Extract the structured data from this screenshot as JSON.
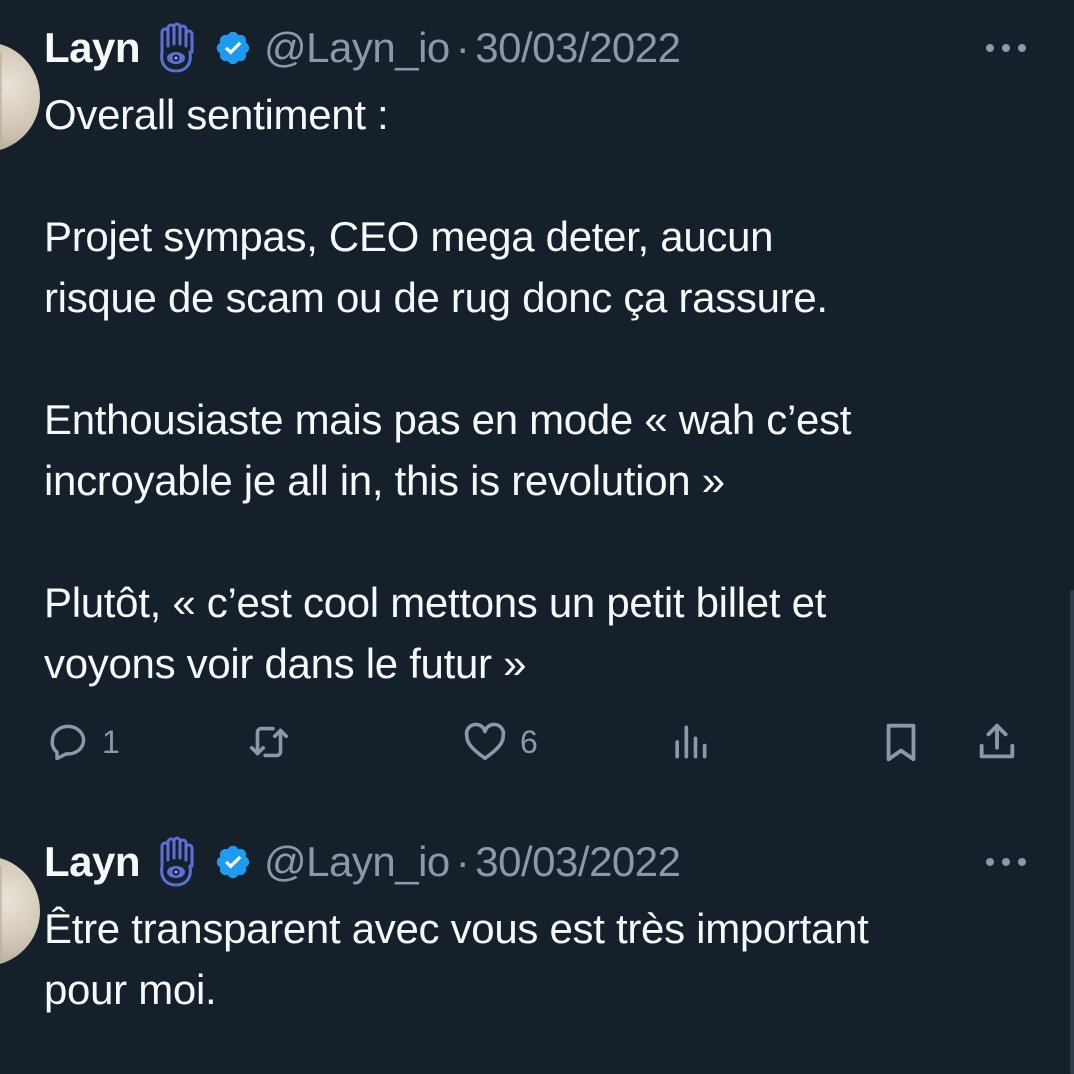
{
  "tweets": [
    {
      "author": {
        "name": "Layn",
        "handle": "@Layn_io",
        "emoji_icon": "hamsa-icon",
        "verified": true
      },
      "separator": "·",
      "date": "30/03/2022",
      "text": "Overall sentiment :\n\nProjet sympas, CEO mega deter, aucun\nrisque de scam ou de rug donc ça rassure.\n\nEnthousiaste mais pas en mode « wah c’est\nincroyable je all in, this is revolution »\n\nPlutôt, « c’est cool mettons un petit billet et\nvoyons voir dans le futur »",
      "stats": {
        "replies": "1",
        "likes": "6"
      }
    },
    {
      "author": {
        "name": "Layn",
        "handle": "@Layn_io",
        "emoji_icon": "hamsa-icon",
        "verified": true
      },
      "separator": "·",
      "date": "30/03/2022",
      "text": "Être transparent avec vous est très important\npour moi."
    }
  ],
  "colors": {
    "background": "#15202b",
    "text": "#f7f9f9",
    "muted": "#8b98a5",
    "verified_blue": "#1d9bf0",
    "hamsa_blue": "#5b6fd6"
  }
}
